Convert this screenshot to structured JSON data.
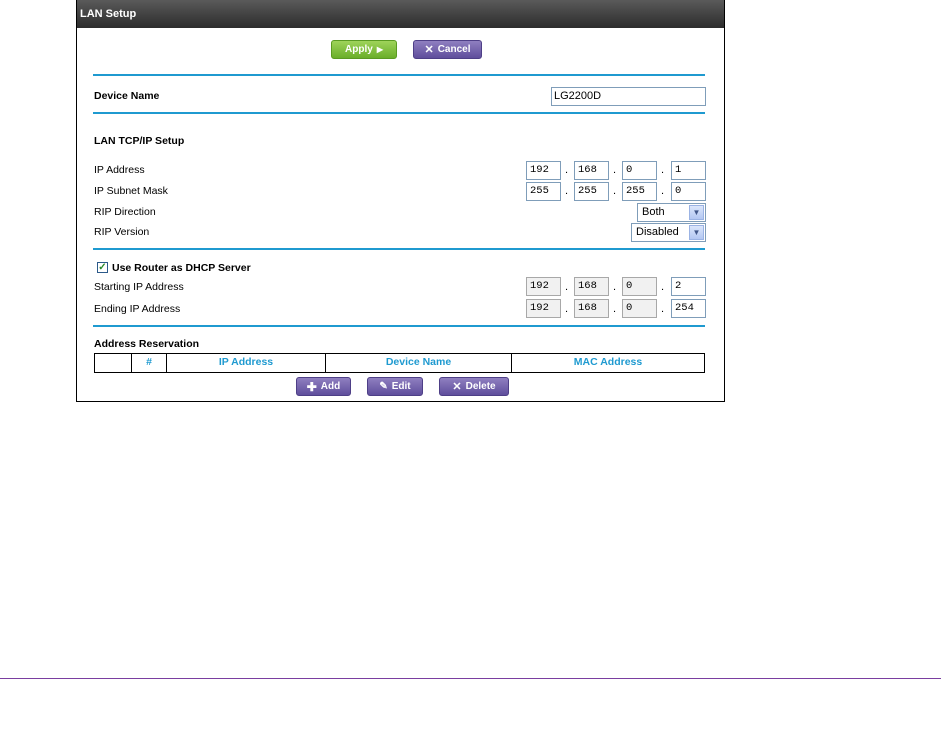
{
  "window": {
    "title": "LAN Setup"
  },
  "toolbar": {
    "apply_label": "Apply",
    "cancel_label": "Cancel"
  },
  "device": {
    "label": "Device Name",
    "value": "LG2200D"
  },
  "lan": {
    "section_title": "LAN TCP/IP Setup",
    "ip_label": "IP Address",
    "ip": [
      "192",
      "168",
      "0",
      "1"
    ],
    "mask_label": "IP Subnet Mask",
    "mask": [
      "255",
      "255",
      "255",
      "0"
    ],
    "rip_direction_label": "RIP Direction",
    "rip_direction_value": "Both",
    "rip_version_label": "RIP Version",
    "rip_version_value": "Disabled"
  },
  "dhcp": {
    "checkbox_label": "Use Router as DHCP Server",
    "checked": true,
    "start_label": "Starting IP Address",
    "start": [
      "192",
      "168",
      "0",
      "2"
    ],
    "end_label": "Ending IP Address",
    "end": [
      "192",
      "168",
      "0",
      "254"
    ]
  },
  "reservation": {
    "title": "Address Reservation",
    "columns": [
      "",
      "#",
      "IP Address",
      "Device Name",
      "MAC Address"
    ],
    "add_label": "Add",
    "edit_label": "Edit",
    "delete_label": "Delete"
  },
  "colors": {
    "accent": "#1f9ad0",
    "apply_green": "#7fbf3f",
    "button_purple": "#6f5fad",
    "footer_rule": "#7a3ea0"
  }
}
